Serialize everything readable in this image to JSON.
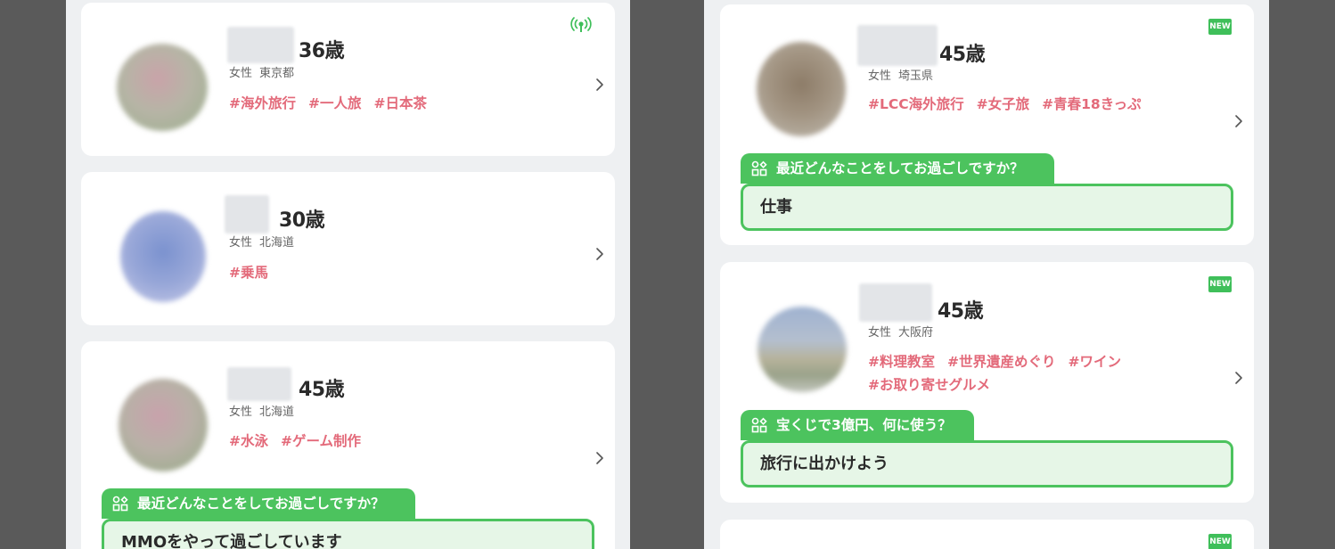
{
  "left": {
    "cards": [
      {
        "age": "36歳",
        "gender": "女性",
        "location": "東京都",
        "tags": [
          "#海外旅行",
          "#一人旅",
          "#日本茶"
        ]
      },
      {
        "age": "30歳",
        "gender": "女性",
        "location": "北海道",
        "tags": [
          "#乗馬"
        ]
      },
      {
        "age": "45歳",
        "gender": "女性",
        "location": "北海道",
        "tags": [
          "#水泳",
          "#ゲーム制作"
        ],
        "question": "最近どんなことをしてお過ごしですか？",
        "answer": "MMOをやって過ごしています"
      }
    ]
  },
  "right": {
    "cards": [
      {
        "age": "45歳",
        "gender": "女性",
        "location": "埼玉県",
        "badge": "NEW",
        "tags": [
          "#LCC海外旅行",
          "#女子旅",
          "#青春18きっぷ"
        ],
        "question": "最近どんなことをしてお過ごしですか？",
        "answer": "仕事"
      },
      {
        "age": "45歳",
        "gender": "女性",
        "location": "大阪府",
        "badge": "NEW",
        "tags": [
          "#料理教室",
          "#世界遺産めぐり",
          "#ワイン",
          "#お取り寄せグルメ"
        ],
        "question": "宝くじで3億円、何に使う？",
        "answer": "旅行に出かけよう"
      },
      {
        "badge": "NEW"
      }
    ]
  },
  "icons": {
    "chevron": "chevron-right-icon",
    "online": "broadcast-signal-icon",
    "question": "question-category-icon"
  },
  "colors": {
    "tag": "#e36a7a",
    "accent_green": "#4cc35e",
    "answer_bg": "#e6f6e7",
    "backdrop": "#5a5a5a"
  }
}
